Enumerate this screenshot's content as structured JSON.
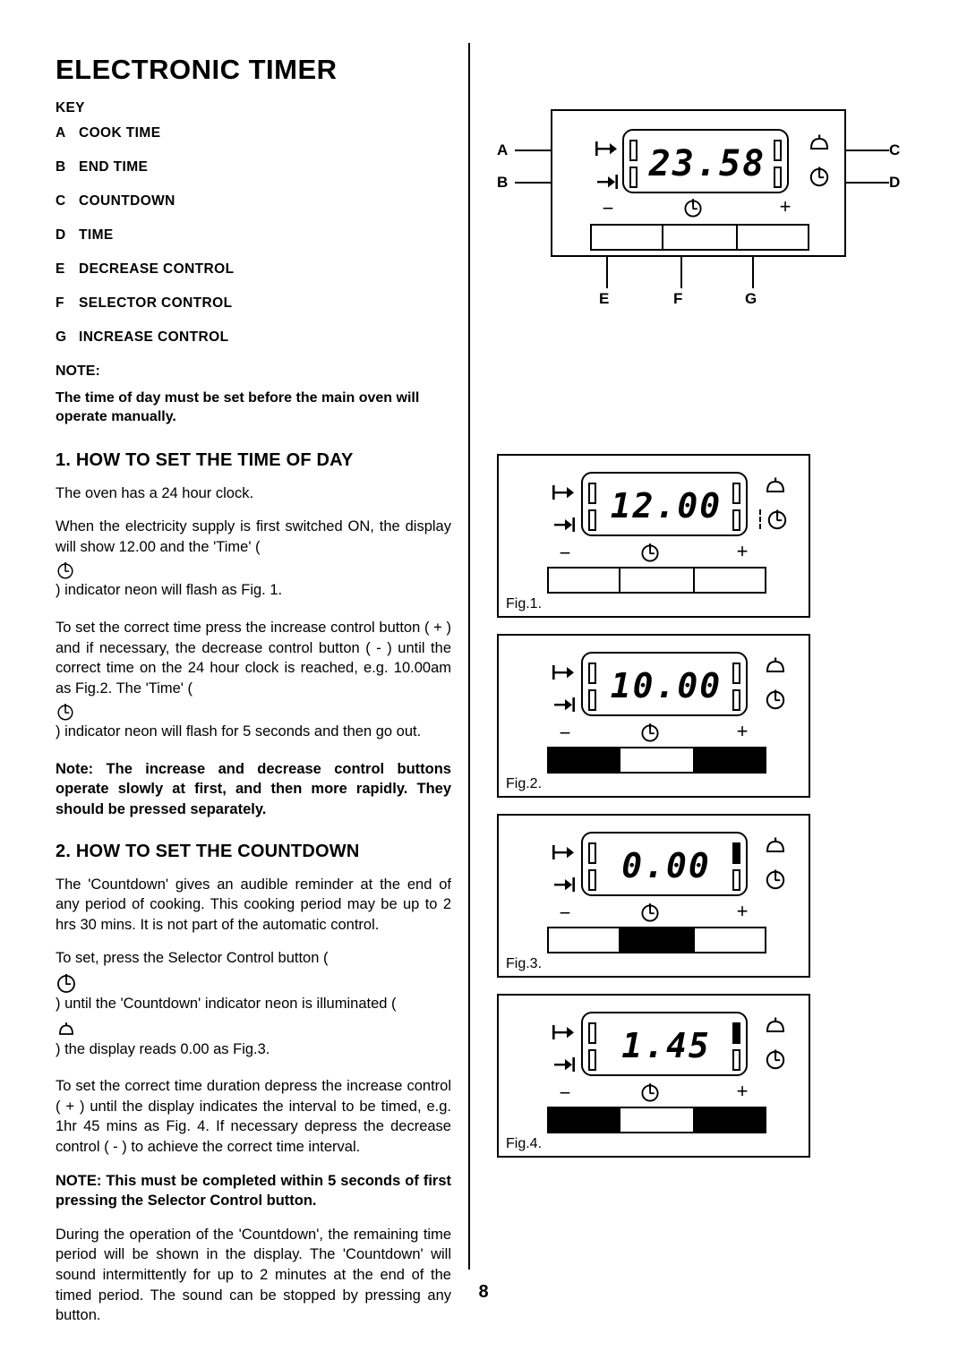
{
  "page": {
    "title": "ELECTRONIC TIMER",
    "number": "8"
  },
  "key": {
    "heading": "KEY",
    "items": [
      {
        "letter": "A",
        "label": "COOK TIME"
      },
      {
        "letter": "B",
        "label": "END TIME"
      },
      {
        "letter": "C",
        "label": "COUNTDOWN"
      },
      {
        "letter": "D",
        "label": "TIME"
      },
      {
        "letter": "E",
        "label": "DECREASE CONTROL"
      },
      {
        "letter": "F",
        "label": "SELECTOR CONTROL"
      },
      {
        "letter": "G",
        "label": "INCREASE CONTROL"
      }
    ]
  },
  "note": {
    "heading": "NOTE:",
    "body": "The time of day must be set before the main oven will operate manually."
  },
  "section1": {
    "heading": "1. HOW TO SET THE TIME OF DAY",
    "p1": "The oven has a 24 hour clock.",
    "p2a": "When the electricity supply is first switched ON, the display will show 12.00 and the 'Time' (",
    "p2b": ") indicator neon will flash as Fig. 1.",
    "p3a": "To set the correct time press the increase control button ( + ) and if necessary, the decrease control button ( - ) until the correct time on the 24 hour clock is reached, e.g. 10.00am as Fig.2.  The 'Time' (",
    "p3b": ") indicator neon will flash for 5 seconds and then go out.",
    "p4": "Note: The increase and decrease control buttons operate slowly at first, and then more rapidly. They should be pressed separately."
  },
  "section2": {
    "heading": "2. HOW TO SET THE COUNTDOWN",
    "p1": "The 'Countdown' gives an audible reminder at the end of any period of cooking.  This cooking period may be  up to 2 hrs 30 mins.  It is not part of the automatic control.",
    "p2a": "To set, press the Selector Control button (",
    "p2b": ") until the 'Countdown' indicator neon is illuminated (",
    "p2c": ") the display reads 0.00 as Fig.3.",
    "p3": "To set the correct time duration depress the increase control ( + ) until the display indicates the interval to be timed, e.g. 1hr 45 mins as Fig. 4.  If necessary depress the decrease control ( - ) to achieve the correct time interval.",
    "p4": "NOTE:  This must be completed within 5 seconds of first pressing the Selector Control button.",
    "p5": "During the operation of the 'Countdown', the remaining time period will be shown in the display. The 'Countdown' will sound intermittently for up to 2 minutes at the end of the timed period.  The sound can be stopped by pressing any button."
  },
  "diagram_main": {
    "display": "23.58",
    "callouts": {
      "a": "A",
      "b": "B",
      "c": "C",
      "d": "D",
      "e": "E",
      "f": "F",
      "g": "G"
    },
    "symbols": {
      "decrease": "−",
      "selector": "clock-icon",
      "increase": "+",
      "bell": "bell-icon",
      "time": "clock-icon",
      "cook": "cook-time-icon",
      "end": "end-time-icon"
    }
  },
  "figures": [
    {
      "label": "Fig.1.",
      "display": "12.00",
      "bell_on": false,
      "clock_on": true,
      "clock_flashing": true,
      "buttons": [
        false,
        false,
        false
      ]
    },
    {
      "label": "Fig.2.",
      "display": "10.00",
      "bell_on": false,
      "clock_on": true,
      "clock_flashing": false,
      "buttons": [
        true,
        false,
        true
      ]
    },
    {
      "label": "Fig.3.",
      "display": "0.00",
      "bell_on": true,
      "clock_on": false,
      "clock_flashing": false,
      "buttons": [
        false,
        true,
        false
      ]
    },
    {
      "label": "Fig.4.",
      "display": "1.45",
      "bell_on": true,
      "clock_on": false,
      "clock_flashing": false,
      "buttons": [
        true,
        false,
        true
      ]
    }
  ]
}
